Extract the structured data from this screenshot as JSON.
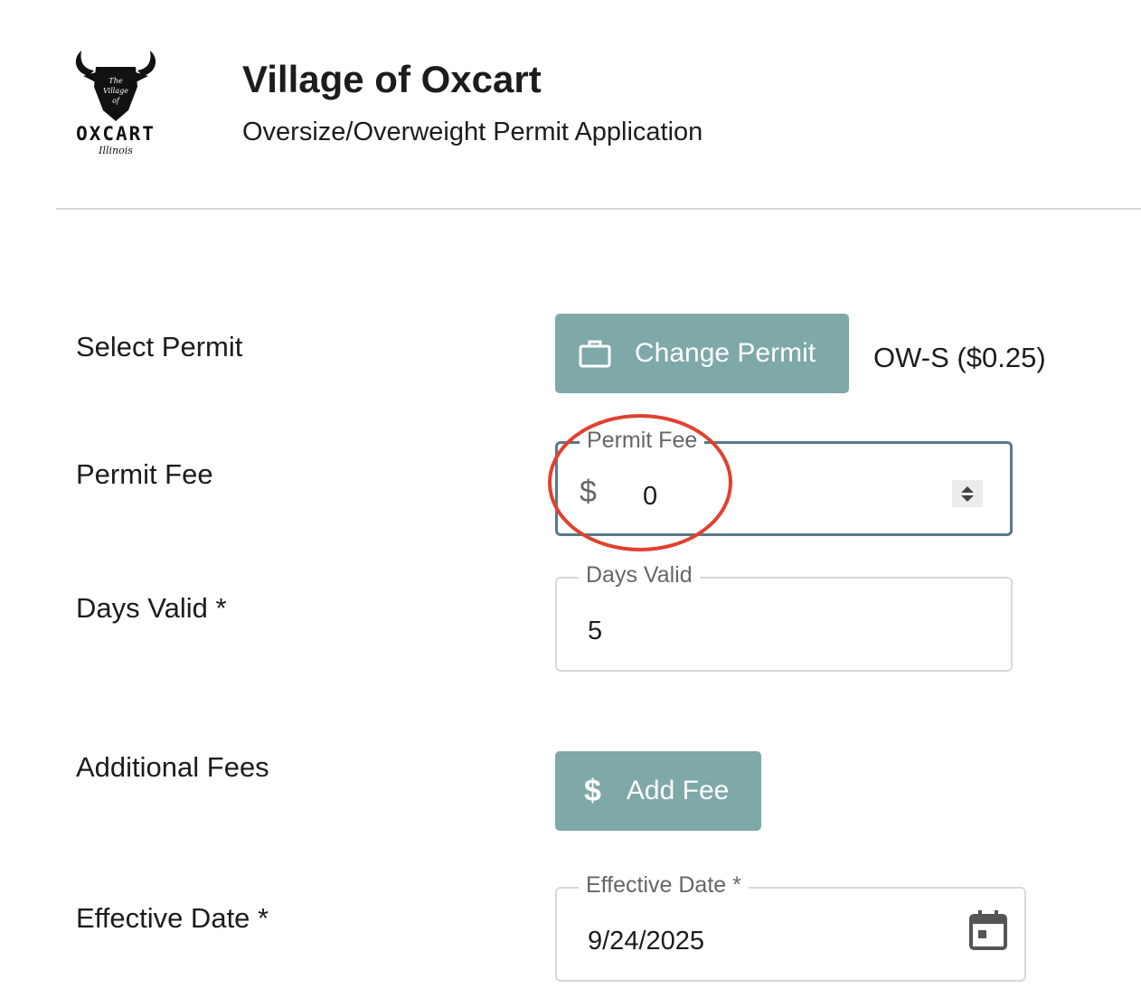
{
  "header": {
    "logo_top_text": "The Village of",
    "logo_word": "OXCART",
    "logo_sub": "Illinois",
    "title": "Village of Oxcart",
    "subtitle": "Oversize/Overweight Permit Application"
  },
  "form": {
    "select_permit": {
      "label": "Select Permit",
      "button_label": "Change Permit",
      "button_icon": "briefcase-icon",
      "current_permit": "OW-S ($0.25)"
    },
    "permit_fee": {
      "label": "Permit Fee",
      "legend": "Permit Fee",
      "prefix": "$",
      "value": "0"
    },
    "days_valid": {
      "label": "Days Valid *",
      "legend": "Days Valid",
      "value": "5"
    },
    "additional_fees": {
      "label": "Additional Fees",
      "button_label": "Add Fee",
      "button_icon": "dollar-icon"
    },
    "effective_date": {
      "label": "Effective Date *",
      "legend": "Effective Date *",
      "value": "9/24/2025",
      "icon": "calendar-icon"
    }
  },
  "colors": {
    "button": "#7fa8a8",
    "focused_border": "#58798a",
    "annotation_circle": "#e0412f"
  }
}
